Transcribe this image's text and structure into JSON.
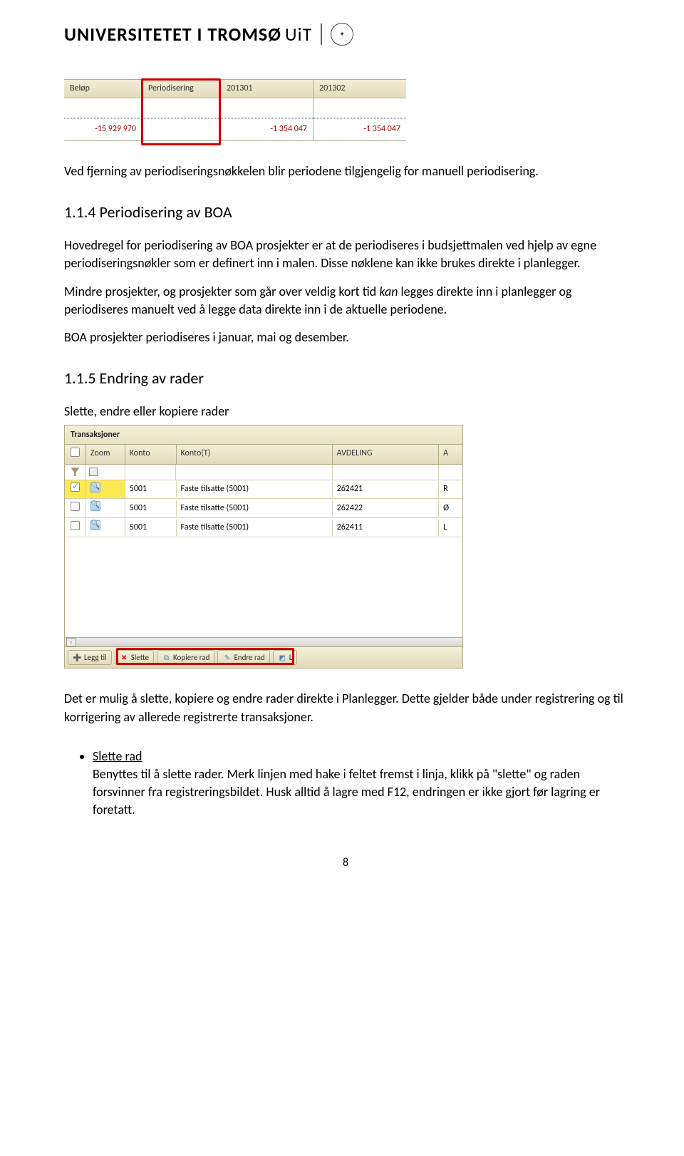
{
  "header": {
    "name": "UNIVERSITETET I TROMSØ",
    "uit": "UiT"
  },
  "minitable": {
    "cols": [
      "Beløp",
      "Periodisering",
      "201301",
      "201302"
    ],
    "vals": [
      "-15 929 970",
      "",
      "-1 354 047",
      "-1 354 047"
    ]
  },
  "p1": "Ved fjerning av periodiseringsnøkkelen blir periodene tilgjengelig for manuell periodisering.",
  "h114": "1.1.4  Periodisering av BOA",
  "p2a": "Hovedregel for periodisering av BOA prosjekter er at de periodiseres i budsjettmalen ved hjelp av egne periodiseringsnøkler som er definert inn i malen. Disse nøklene kan ikke brukes direkte i planlegger.",
  "p2b_pre": "Mindre prosjekter, og prosjekter som går over veldig kort tid ",
  "p2b_em": "kan",
  "p2b_post": " legges direkte inn i planlegger og periodiseres manuelt ved å legge data direkte inn i de aktuelle periodene.",
  "p3": "BOA prosjekter periodiseres i januar, mai og desember.",
  "h115": "1.1.5  Endring av rader",
  "p4": "Slette, endre eller kopiere rader",
  "ss2": {
    "title": "Transaksjoner",
    "headers": {
      "zoom": "Zoom",
      "konto": "Konto",
      "kontot": "Konto(T)",
      "avd": "AVDELING",
      "a": "A"
    },
    "rows": [
      {
        "checked": true,
        "konto": "5001",
        "kontot": "Faste tilsatte (5001)",
        "avd": "262421",
        "a": "R"
      },
      {
        "checked": false,
        "konto": "5001",
        "kontot": "Faste tilsatte (5001)",
        "avd": "262422",
        "a": "Ø"
      },
      {
        "checked": false,
        "konto": "5001",
        "kontot": "Faste tilsatte (5001)",
        "avd": "262411",
        "a": "L"
      }
    ],
    "buttons": {
      "legg": "Legg til",
      "slette": "Slette",
      "kopiere": "Kopiere rad",
      "endre": "Endre rad",
      "l": "L"
    }
  },
  "p5": "Det er mulig å slette, kopiere og endre rader direkte i Planlegger. Dette gjelder både under registrering og til korrigering av allerede registrerte transaksjoner.",
  "bullet_title": "Slette rad",
  "bullet_body": "Benyttes til å slette rader. Merk linjen med hake i feltet fremst i linja, klikk på \"slette\" og raden forsvinner fra registreringsbildet. Husk alltid å lagre med F12, endringen er ikke gjort før lagring er foretatt.",
  "pagenum": "8"
}
